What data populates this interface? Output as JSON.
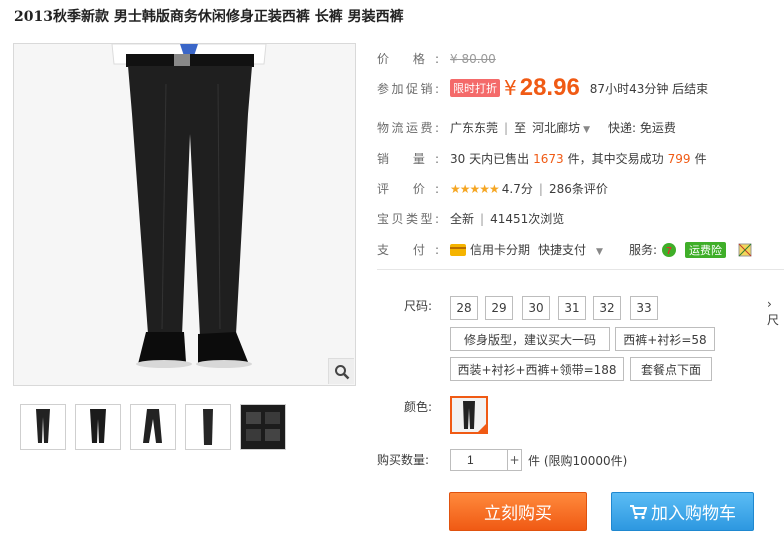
{
  "product": {
    "title": "2013秋季新款 男士韩版商务休闲修身正装西裤 长裤 男装西裤"
  },
  "gallery": {
    "thumb_count": 5
  },
  "price": {
    "label": "价 格:",
    "original": "¥ 80.00"
  },
  "promo": {
    "label": "参加促销:",
    "tag": "限时打折",
    "currency": "¥",
    "price": "28.96",
    "countdown": "87小时43分钟 后结束"
  },
  "shipping": {
    "label": "物流运费:",
    "from": "广东东莞",
    "sep": "|",
    "to_prefix": "至",
    "to": "河北廊坊",
    "fee": "快递: 免运费"
  },
  "sales": {
    "label": "销 量:",
    "prefix": "30 天内已售出",
    "sold": "1673",
    "mid": "件，其中交易成功",
    "success": "799",
    "suffix": "件"
  },
  "rating": {
    "label": "评 价:",
    "stars": "★★★★★",
    "score": "4.7分",
    "sep": "|",
    "reviews": "286条评价"
  },
  "item_type": {
    "label": "宝贝类型:",
    "condition": "全新",
    "sep": "|",
    "views": "41451次浏览"
  },
  "payment": {
    "label": "支 付:",
    "installment": "信用卡分期",
    "quick": "快捷支付",
    "service_label": "服务:",
    "freight_ins": "运费险"
  },
  "options": {
    "size_label": "尺码:",
    "sizes": [
      "28",
      "29",
      "30",
      "31",
      "32",
      "33"
    ],
    "notes": [
      "修身版型，建议买大一码",
      "西裤+衬衫=58",
      "西装+衬衫+西裤+领带=188",
      "套餐点下面"
    ],
    "color_label": "颜色:",
    "qty_label": "购买数量:",
    "qty_value": "1",
    "qty_plus": "+",
    "qty_note": "件 (限购10000件)",
    "more": "尺"
  },
  "actions": {
    "buy_label": "立刻购买",
    "cart_label": "加入购物车"
  },
  "colors": {
    "accent": "#f05a14",
    "buy": "#f05a14",
    "cart": "#2d98e0"
  }
}
